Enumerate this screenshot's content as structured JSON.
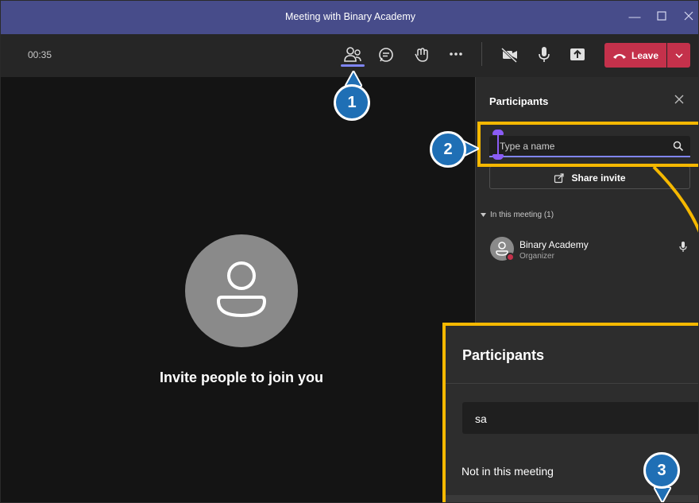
{
  "window": {
    "title": "Meeting with Binary Academy"
  },
  "toolbar": {
    "timer": "00:35",
    "leave_label": "Leave"
  },
  "stage": {
    "invite_text": "Invite people to join you"
  },
  "panel": {
    "title": "Participants",
    "search_placeholder": "Type a name",
    "share_label": "Share invite",
    "section_label": "In this meeting (1)",
    "participant_name": "Binary Academy",
    "participant_role": "Organizer"
  },
  "zoom": {
    "title": "Participants",
    "search_value": "sa",
    "section_label": "Not in this meeting"
  },
  "markers": {
    "one": "1",
    "two": "2",
    "three": "3"
  },
  "colors": {
    "titlebar": "#474c8a",
    "accent": "#7f85f5",
    "leave": "#c4314b",
    "highlight": "#f5b800",
    "marker": "#1f6fb5"
  }
}
